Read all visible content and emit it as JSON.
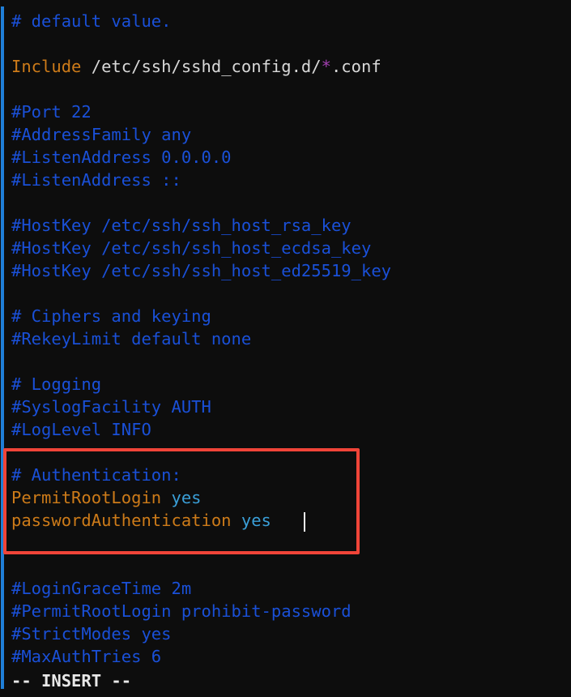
{
  "app": {
    "type": "terminal-text-editor",
    "editor": "vim",
    "file_kind": "sshd_config"
  },
  "theme": {
    "background": "#0d0d0d",
    "comment": "#1a50d8",
    "keyword": "#cd7b19",
    "path": "#d8d8d8",
    "glob": "#a13fb0",
    "value": "#3a9fd8",
    "status_text": "#e8e8e8",
    "left_edge": "#1f7fd8",
    "highlight_border": "#f04438",
    "caret": "#f2f2f2"
  },
  "lines": [
    {
      "id": "l1",
      "segments": [
        {
          "text": "# default value.",
          "style": "cmt"
        }
      ]
    },
    {
      "id": "l2",
      "segments": []
    },
    {
      "id": "l3",
      "segments": [
        {
          "text": "Include ",
          "style": "kw"
        },
        {
          "text": "/etc/ssh/sshd_config.d/",
          "style": "path"
        },
        {
          "text": "*",
          "style": "glob"
        },
        {
          "text": ".conf",
          "style": "path"
        }
      ]
    },
    {
      "id": "l4",
      "segments": []
    },
    {
      "id": "l5",
      "segments": [
        {
          "text": "#Port 22",
          "style": "cmt"
        }
      ]
    },
    {
      "id": "l6",
      "segments": [
        {
          "text": "#AddressFamily any",
          "style": "cmt"
        }
      ]
    },
    {
      "id": "l7",
      "segments": [
        {
          "text": "#ListenAddress 0.0.0.0",
          "style": "cmt"
        }
      ]
    },
    {
      "id": "l8",
      "segments": [
        {
          "text": "#ListenAddress ::",
          "style": "cmt"
        }
      ]
    },
    {
      "id": "l9",
      "segments": []
    },
    {
      "id": "l10",
      "segments": [
        {
          "text": "#HostKey /etc/ssh/ssh_host_rsa_key",
          "style": "cmt"
        }
      ]
    },
    {
      "id": "l11",
      "segments": [
        {
          "text": "#HostKey /etc/ssh/ssh_host_ecdsa_key",
          "style": "cmt"
        }
      ]
    },
    {
      "id": "l12",
      "segments": [
        {
          "text": "#HostKey /etc/ssh/ssh_host_ed25519_key",
          "style": "cmt"
        }
      ]
    },
    {
      "id": "l13",
      "segments": []
    },
    {
      "id": "l14",
      "segments": [
        {
          "text": "# Ciphers and keying",
          "style": "cmt"
        }
      ]
    },
    {
      "id": "l15",
      "segments": [
        {
          "text": "#RekeyLimit default none",
          "style": "cmt"
        }
      ]
    },
    {
      "id": "l16",
      "segments": []
    },
    {
      "id": "l17",
      "segments": [
        {
          "text": "# Logging",
          "style": "cmt"
        }
      ]
    },
    {
      "id": "l18",
      "segments": [
        {
          "text": "#SyslogFacility AUTH",
          "style": "cmt"
        }
      ]
    },
    {
      "id": "l19",
      "segments": [
        {
          "text": "#LogLevel INFO",
          "style": "cmt"
        }
      ]
    },
    {
      "id": "l20",
      "segments": []
    },
    {
      "id": "l21",
      "segments": [
        {
          "text": "# Authentication:",
          "style": "cmt"
        }
      ]
    },
    {
      "id": "l22",
      "segments": [
        {
          "text": "PermitRootLogin ",
          "style": "kw"
        },
        {
          "text": "yes",
          "style": "val"
        }
      ]
    },
    {
      "id": "l23",
      "segments": [
        {
          "text": "passwordAuthentication ",
          "style": "kw"
        },
        {
          "text": "yes",
          "style": "val"
        }
      ]
    },
    {
      "id": "l24",
      "segments": []
    },
    {
      "id": "l25",
      "segments": []
    },
    {
      "id": "l26",
      "segments": [
        {
          "text": "#LoginGraceTime 2m",
          "style": "cmt"
        }
      ]
    },
    {
      "id": "l27",
      "segments": [
        {
          "text": "#PermitRootLogin prohibit-password",
          "style": "cmt"
        }
      ]
    },
    {
      "id": "l28",
      "segments": [
        {
          "text": "#StrictModes yes",
          "style": "cmt"
        }
      ]
    },
    {
      "id": "l29",
      "segments": [
        {
          "text": "#MaxAuthTries 6",
          "style": "cmt"
        }
      ]
    }
  ],
  "status_line": "-- INSERT --",
  "annotation": {
    "kind": "red-rectangle-highlight",
    "covers_lines": [
      "# Authentication:",
      "PermitRootLogin yes",
      "passwordAuthentication yes"
    ]
  }
}
